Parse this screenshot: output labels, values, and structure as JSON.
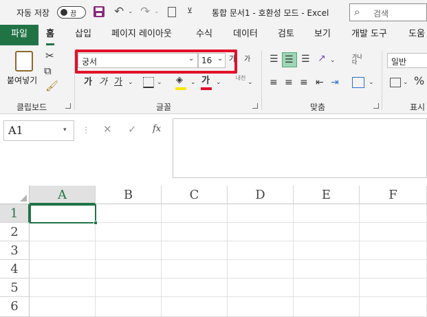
{
  "title_bar": {
    "autosave_label": "자동 저장",
    "autosave_state": "끔",
    "doc_title": "통합 문서1 - 호환성 모드 - Excel",
    "search_placeholder": "검색"
  },
  "tabs": [
    "파일",
    "홈",
    "삽입",
    "페이지 레이아웃",
    "수식",
    "데이터",
    "검토",
    "보기",
    "개발 도구",
    "도움"
  ],
  "active_tab": "홈",
  "clipboard": {
    "paste_label": "붙여넣기",
    "group_label": "클립보드"
  },
  "font": {
    "name": "궁서",
    "size": "16",
    "grow": "가",
    "shrink": "가",
    "bold": "가",
    "italic": "가",
    "underline": "가",
    "phonetic": "내천",
    "group_label": "글꼴",
    "font_color_char": "가"
  },
  "alignment": {
    "wrap_label": "가나다",
    "group_label": "맞춤"
  },
  "number": {
    "format": "일반",
    "percent": "%",
    "group_label": "표시"
  },
  "formula_bar": {
    "name_box": "A1",
    "fx": "fx",
    "formula": ""
  },
  "grid": {
    "columns": [
      "A",
      "B",
      "C",
      "D",
      "E",
      "F"
    ],
    "rows": [
      "1",
      "2",
      "3",
      "4",
      "5",
      "6"
    ],
    "selected_cell": "A1"
  },
  "colors": {
    "accent": "#217346",
    "highlight": "#e2102a",
    "header_selected": "#e1e1e1"
  }
}
